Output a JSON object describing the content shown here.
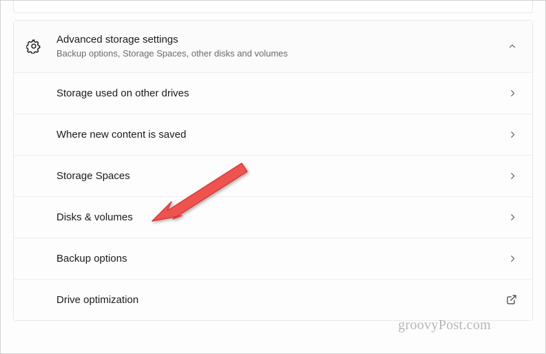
{
  "header": {
    "title": "Advanced storage settings",
    "subtitle": "Backup options, Storage Spaces, other disks and volumes"
  },
  "items": [
    {
      "label": "Storage used on other drives",
      "action": "navigate"
    },
    {
      "label": "Where new content is saved",
      "action": "navigate"
    },
    {
      "label": "Storage Spaces",
      "action": "navigate"
    },
    {
      "label": "Disks & volumes",
      "action": "navigate"
    },
    {
      "label": "Backup options",
      "action": "navigate"
    },
    {
      "label": "Drive optimization",
      "action": "external"
    }
  ],
  "watermark": "groovyPost.com"
}
